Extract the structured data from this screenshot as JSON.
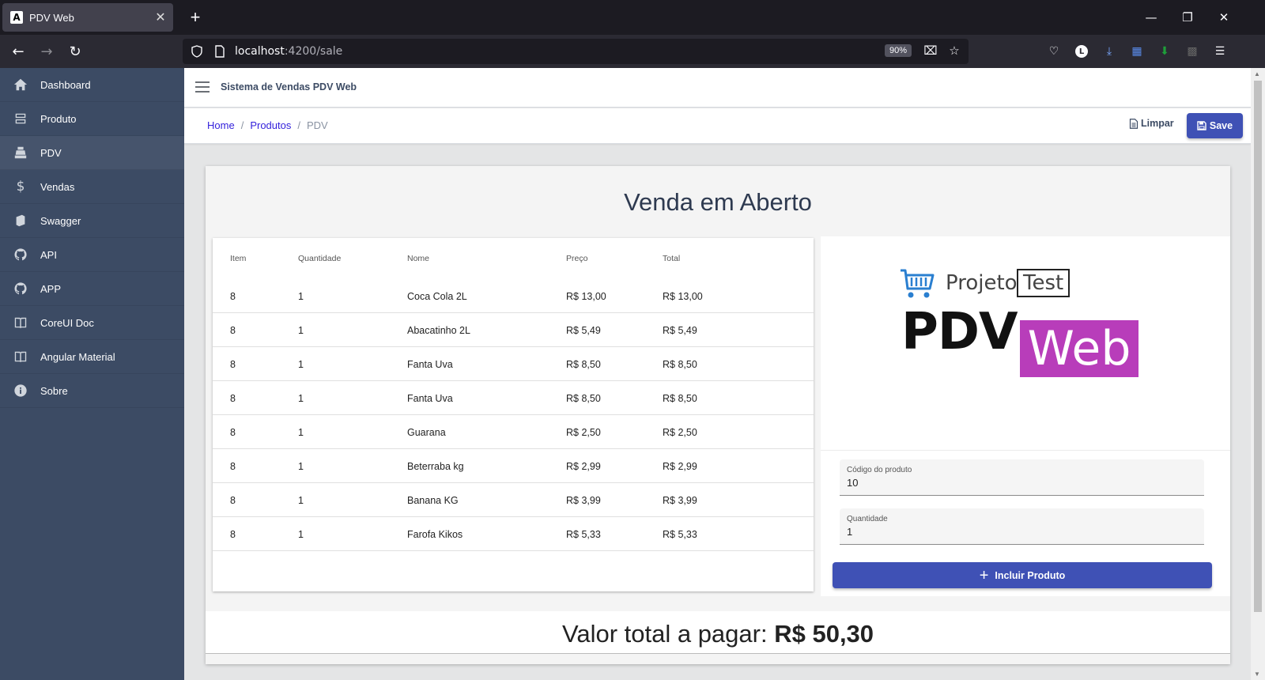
{
  "browser": {
    "tab_title": "PDV Web",
    "tab_favicon": "A",
    "url_host": "localhost",
    "url_path": ":4200/sale",
    "zoom": "90%"
  },
  "app": {
    "title": "Sistema de Vendas PDV Web",
    "accent_color": "#3f51b5",
    "sidebar_color": "#3c4b64"
  },
  "sidebar": {
    "items": [
      {
        "label": "Dashboard",
        "icon": "home-icon"
      },
      {
        "label": "Produto",
        "icon": "list-icon"
      },
      {
        "label": "PDV",
        "icon": "cash-register-icon",
        "active": true
      },
      {
        "label": "Vendas",
        "icon": "dollar-icon"
      },
      {
        "label": "Swagger",
        "icon": "book-icon"
      },
      {
        "label": "API",
        "icon": "github-icon"
      },
      {
        "label": "APP",
        "icon": "github-icon"
      },
      {
        "label": "CoreUI Doc",
        "icon": "document-icon"
      },
      {
        "label": "Angular Material",
        "icon": "document-icon"
      },
      {
        "label": "Sobre",
        "icon": "info-icon"
      }
    ]
  },
  "breadcrumb": {
    "home": "Home",
    "produtos": "Produtos",
    "current": "PDV",
    "separator": "/"
  },
  "actions": {
    "limpar": "Limpar",
    "save": "Save"
  },
  "sale": {
    "title": "Venda em Aberto",
    "columns": [
      "Item",
      "Quantidade",
      "Nome",
      "Preço",
      "Total"
    ],
    "rows": [
      [
        "8",
        "1",
        "Coca Cola 2L",
        "R$ 13,00",
        "R$ 13,00"
      ],
      [
        "8",
        "1",
        "Abacatinho 2L",
        "R$ 5,49",
        "R$ 5,49"
      ],
      [
        "8",
        "1",
        "Fanta Uva",
        "R$ 8,50",
        "R$ 8,50"
      ],
      [
        "8",
        "1",
        "Fanta Uva",
        "R$ 8,50",
        "R$ 8,50"
      ],
      [
        "8",
        "1",
        "Guarana",
        "R$ 2,50",
        "R$ 2,50"
      ],
      [
        "8",
        "1",
        "Beterraba kg",
        "R$ 2,99",
        "R$ 2,99"
      ],
      [
        "8",
        "1",
        "Banana KG",
        "R$ 3,99",
        "R$ 3,99"
      ],
      [
        "8",
        "1",
        "Farofa Kikos",
        "R$ 5,33",
        "R$ 5,33"
      ]
    ]
  },
  "logo": {
    "projeto": "Projeto",
    "test": "Test",
    "pdv": "PDV",
    "web": "Web"
  },
  "form": {
    "codigo_label": "Código do produto",
    "codigo_value": "10",
    "quantidade_label": "Quantidade",
    "quantidade_value": "1",
    "add_button": "Incluir Produto"
  },
  "total": {
    "label": "Valor total a pagar:",
    "value": "R$ 50,30"
  }
}
